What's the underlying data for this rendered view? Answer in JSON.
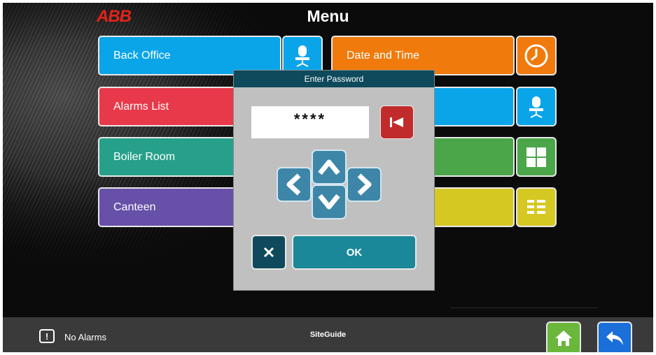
{
  "header": {
    "logo": "ABB",
    "title": "Menu"
  },
  "menu": {
    "left_tiles": [
      {
        "label": "Back Office",
        "color": "#0aa5e8",
        "icon": "operator-chair-icon"
      },
      {
        "label": "Alarms List",
        "color": "#e8394a"
      },
      {
        "label": "Boiler Room",
        "color": "#27a08b"
      },
      {
        "label": "Canteen",
        "color": "#6750a8"
      }
    ],
    "right_tiles": [
      {
        "label": "Date and Time",
        "color": "#f07a0c",
        "icon": "clock-icon"
      },
      {
        "label": "",
        "color": "#0aa5e8",
        "icon": "operator-chair-icon"
      },
      {
        "label": "",
        "color": "#4aa648",
        "icon": "grid-icon"
      },
      {
        "label": "",
        "color": "#d6c823",
        "icon": "list-icon"
      }
    ]
  },
  "dialog": {
    "title": "Enter Password",
    "password_value": "****",
    "ok_label": "OK",
    "colors": {
      "header": "#0e4a5c",
      "clear": "#c22b2b",
      "arrow": "#3d86a8",
      "ok": "#1a8899"
    }
  },
  "statusbar": {
    "alarm_text": "No Alarms",
    "alarm_icon": "!",
    "app_name": "SiteGuide",
    "home_color": "#6ab73c",
    "back_color": "#1a6fd8"
  }
}
